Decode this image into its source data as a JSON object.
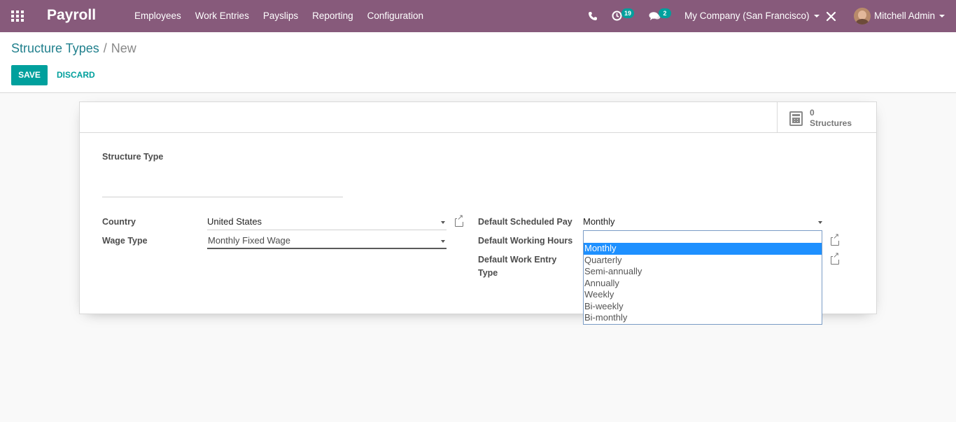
{
  "navbar": {
    "app_name": "Payroll",
    "menu": [
      "Employees",
      "Work Entries",
      "Payslips",
      "Reporting",
      "Configuration"
    ],
    "activity_count": "19",
    "message_count": "2",
    "company": "My Company (San Francisco)",
    "user": "Mitchell Admin"
  },
  "breadcrumb": {
    "parent": "Structure Types",
    "separator": "/",
    "current": "New"
  },
  "buttons": {
    "save": "SAVE",
    "discard": "DISCARD"
  },
  "stat_button": {
    "value": "0",
    "label": "Structures"
  },
  "form": {
    "name_label": "Structure Type",
    "country": {
      "label": "Country",
      "value": "United States"
    },
    "wage_type": {
      "label": "Wage Type",
      "value": "Monthly Fixed Wage"
    },
    "scheduled_pay": {
      "label": "Default Scheduled Pay",
      "value": "Monthly"
    },
    "working_hours": {
      "label": "Default Working Hours"
    },
    "work_entry_type": {
      "label_line1": "Default Work Entry",
      "label_line2": "Type"
    }
  },
  "dropdown": {
    "options": [
      "Monthly",
      "Quarterly",
      "Semi-annually",
      "Annually",
      "Weekly",
      "Bi-weekly",
      "Bi-monthly"
    ],
    "selected": "Monthly"
  }
}
